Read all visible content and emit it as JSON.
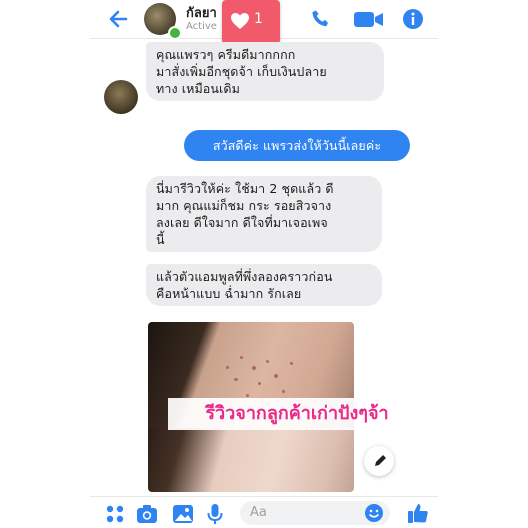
{
  "header": {
    "contact_name": "กัลยา",
    "status": "Active",
    "like_count": "1",
    "accent": "#2f84f2"
  },
  "messages": [
    {
      "side": "in",
      "text": "คุณแพรวๆ ครีมดีมากกกก\nมาสั่งเพิ่มอีกชุดจ้า เก็บเงินปลาย\nทาง เหมือนเดิม"
    },
    {
      "side": "out",
      "text": "สวัสดีค่ะ แพรวส่งให้วันนี้เลยค่ะ"
    },
    {
      "side": "in",
      "text": "นี่มารีวิวให้ค่ะ ใช้มา 2 ชุดแล้ว ดี\nมาก คุณแม่ก็ชม กระ รอยสิวจาง\nลงเลย ดีใจมาก ดีใจที่มาเจอเพจ\nนี้"
    },
    {
      "side": "in",
      "text": "แล้วตัวแอมพูลที่พึ่งลองคราวก่อน\nคือหน้าแบบ ฉ่ำมาก รักเลย"
    }
  ],
  "photo": {
    "caption": "รีวิวจากลูกค้าเก่าปังๆจ้า",
    "caption_color": "#ea2a8a"
  },
  "composer": {
    "placeholder": "Aa"
  },
  "icons": [
    "back-arrow-icon",
    "phone-icon",
    "video-call-icon",
    "info-icon",
    "apps-icon",
    "camera-icon",
    "gallery-icon",
    "microphone-icon",
    "emoji-icon",
    "thumbs-up-icon",
    "pencil-icon",
    "heart-icon"
  ]
}
